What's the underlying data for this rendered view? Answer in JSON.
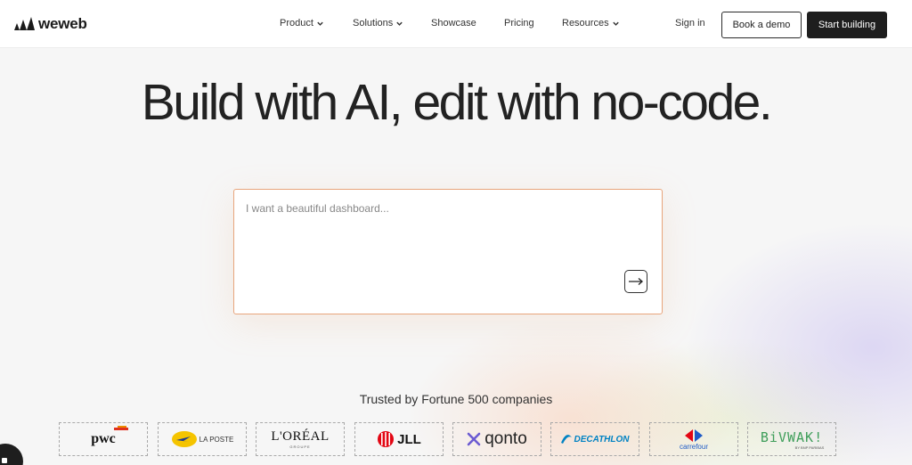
{
  "brand": {
    "name": "weweb"
  },
  "nav": {
    "items": [
      {
        "label": "Product",
        "dropdown": true
      },
      {
        "label": "Solutions",
        "dropdown": true
      },
      {
        "label": "Showcase",
        "dropdown": false
      },
      {
        "label": "Pricing",
        "dropdown": false
      },
      {
        "label": "Resources",
        "dropdown": true
      }
    ],
    "sign_in": "Sign in",
    "book_demo": "Book a demo",
    "start_building": "Start building"
  },
  "hero": {
    "title": "Build with AI, edit with no-code."
  },
  "prompt": {
    "placeholder": "I want a beautiful dashboard...",
    "value": ""
  },
  "trusted": {
    "heading": "Trusted by Fortune 500 companies",
    "logos": [
      "pwc",
      "LA POSTE",
      "L'ORÉAL",
      "JLL",
      "qonto",
      "DECATHLON",
      "carrefour",
      "BiVWAK!"
    ],
    "logo_subtext": {
      "loreal": "GROUPE",
      "bivwak": "BY BNP PARIBAS"
    }
  },
  "colors": {
    "accent_border": "#e8a57c",
    "dark_button": "#1e1e1e"
  }
}
